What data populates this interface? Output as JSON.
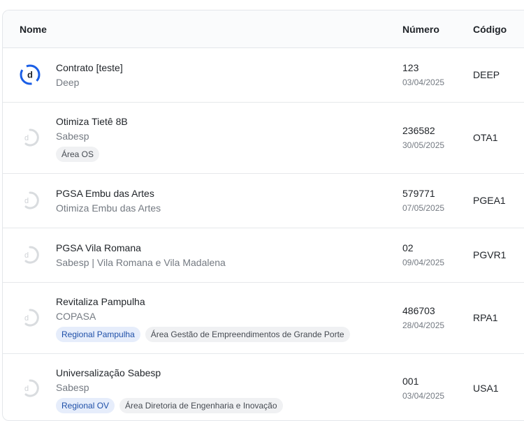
{
  "header": {
    "name": "Nome",
    "number": "Número",
    "code": "Código"
  },
  "rows": [
    {
      "title": "Contrato [teste]",
      "subtitle": "Deep",
      "tags": [],
      "number": "123",
      "date": "03/04/2025",
      "code": "DEEP",
      "logo": "deep-logo-icon",
      "logo_letter": "d"
    },
    {
      "title": "Otimiza Tietê 8B",
      "subtitle": "Sabesp",
      "tags": [
        {
          "label": "Área OS",
          "style": "gray"
        }
      ],
      "number": "236582",
      "date": "30/05/2025",
      "code": "OTA1",
      "logo": "placeholder-logo-icon",
      "logo_letter": "d"
    },
    {
      "title": "PGSA Embu das Artes",
      "subtitle": "Otimiza Embu das Artes",
      "tags": [],
      "number": "579771",
      "date": "07/05/2025",
      "code": "PGEA1",
      "logo": "placeholder-logo-icon",
      "logo_letter": "d"
    },
    {
      "title": "PGSA Vila Romana",
      "subtitle": "Sabesp | Vila Romana e Vila Madalena",
      "tags": [],
      "number": "02",
      "date": "09/04/2025",
      "code": "PGVR1",
      "logo": "placeholder-logo-icon",
      "logo_letter": "d"
    },
    {
      "title": "Revitaliza Pampulha",
      "subtitle": "COPASA",
      "tags": [
        {
          "label": "Regional Pampulha",
          "style": "blue"
        },
        {
          "label": "Área Gestão de Empreendimentos de Grande Porte",
          "style": "gray"
        }
      ],
      "number": "486703",
      "date": "28/04/2025",
      "code": "RPA1",
      "logo": "placeholder-logo-icon",
      "logo_letter": "d"
    },
    {
      "title": "Universalização Sabesp",
      "subtitle": "Sabesp",
      "tags": [
        {
          "label": "Regional OV",
          "style": "blue"
        },
        {
          "label": "Área Diretoria de Engenharia e Inovação",
          "style": "gray"
        }
      ],
      "number": "001",
      "date": "03/04/2025",
      "code": "USA1",
      "logo": "placeholder-logo-icon",
      "logo_letter": "d"
    }
  ],
  "colors": {
    "accent": "#1a5ee6",
    "muted": "#d9dcdf"
  }
}
